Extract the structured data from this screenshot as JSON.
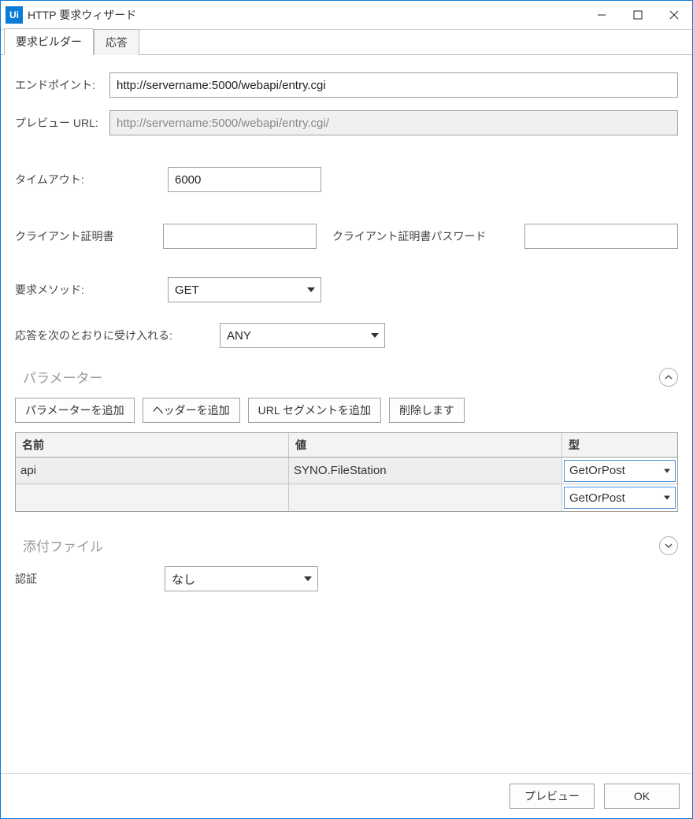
{
  "window": {
    "title": "HTTP 要求ウィザード",
    "app_icon_text": "Ui"
  },
  "tabs": [
    {
      "label": "要求ビルダー",
      "active": true
    },
    {
      "label": "応答",
      "active": false
    }
  ],
  "form": {
    "endpoint_label": "エンドポイント:",
    "endpoint_value": "http://servername:5000/webapi/entry.cgi",
    "preview_url_label": "プレビュー URL:",
    "preview_url_value": "http://servername:5000/webapi/entry.cgi/",
    "timeout_label": "タイムアウト:",
    "timeout_value": "6000",
    "client_cert_label": "クライアント証明書",
    "client_cert_value": "",
    "client_cert_pw_label": "クライアント証明書パスワード",
    "client_cert_pw_value": "",
    "method_label": "要求メソッド:",
    "method_value": "GET",
    "accept_label": "応答を次のとおりに受け入れる:",
    "accept_value": "ANY",
    "auth_label": "認証",
    "auth_value": "なし"
  },
  "sections": {
    "params_title": "パラメーター",
    "attachments_title": "添付ファイル"
  },
  "param_buttons": {
    "add_param": "パラメーターを追加",
    "add_header": "ヘッダーを追加",
    "add_url_segment": "URL セグメントを追加",
    "delete": "削除します"
  },
  "grid": {
    "headers": {
      "name": "名前",
      "value": "値",
      "type": "型"
    },
    "rows": [
      {
        "name": "api",
        "value": "SYNO.FileStation",
        "type": "GetOrPost"
      },
      {
        "name": "",
        "value": "",
        "type": "GetOrPost"
      }
    ]
  },
  "footer": {
    "preview": "プレビュー",
    "ok": "OK"
  }
}
